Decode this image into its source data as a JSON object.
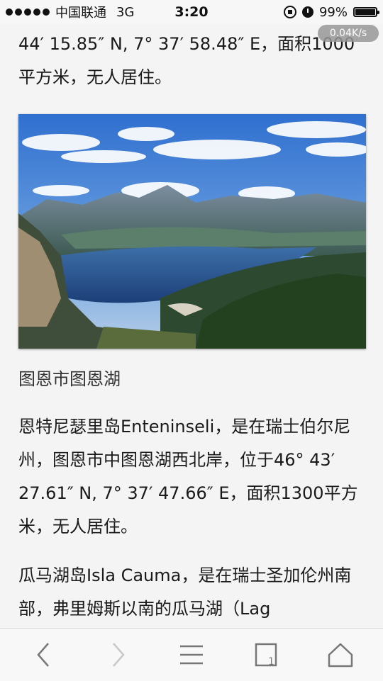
{
  "status_bar": {
    "carrier": "中国联通",
    "network": "3G",
    "time": "3:20",
    "battery": "99%",
    "battery_level": 0.99
  },
  "speed_badge": "0.04K/s",
  "article": {
    "para1": "44′ 15.85″ N, 7° 37′ 58.48″ E，面积1000平方米，无人居住。",
    "image_caption": "图恩市图恩湖",
    "para2": "恩特尼瑟里岛Enteninseli，是在瑞士伯尔尼州，图恩市中图恩湖西北岸，位于46° 43′ 27.61″ N, 7° 37′ 47.66″ E，面积1300平方米，无人居住。",
    "para3": "瓜马湖岛Isla Cauma，是在瑞士圣加伦州南部，弗里姆斯以南的瓜马湖（Lag"
  },
  "toolbar": {
    "icons": [
      "back-arrow-icon",
      "forward-arrow-icon",
      "menu-icon",
      "tabs-icon",
      "home-icon"
    ]
  }
}
